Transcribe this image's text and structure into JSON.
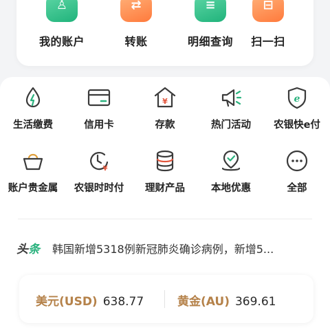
{
  "top_actions": [
    {
      "label": "我的账户",
      "icon": "account-icon",
      "color": "#20b37b"
    },
    {
      "label": "转账",
      "icon": "transfer-icon",
      "color": "#ff7a3c"
    },
    {
      "label": "明细查询",
      "icon": "detail-query-icon",
      "color": "#20b37b"
    },
    {
      "label": "扫一扫",
      "icon": "scan-icon",
      "color": "#ff7a3c"
    }
  ],
  "services": [
    {
      "label": "生活缴费",
      "icon": "water-drop-icon"
    },
    {
      "label": "信用卡",
      "icon": "credit-card-icon"
    },
    {
      "label": "存款",
      "icon": "deposit-house-icon"
    },
    {
      "label": "热门活动",
      "icon": "megaphone-icon"
    },
    {
      "label": "农银快e付",
      "icon": "e-pay-shield-icon"
    },
    {
      "label": "账户贵金属",
      "icon": "gold-bowl-icon"
    },
    {
      "label": "农银时时付",
      "icon": "clock-yuan-icon"
    },
    {
      "label": "理财产品",
      "icon": "coin-stack-icon"
    },
    {
      "label": "本地优惠",
      "icon": "location-pin-icon"
    },
    {
      "label": "全部",
      "icon": "more-dots-icon"
    }
  ],
  "news": {
    "tag_part1": "头",
    "tag_part2": "条",
    "headline": "韩国新增5318例新冠肺炎确诊病例，新增5..."
  },
  "rates": {
    "usd_label": "美元(USD)",
    "usd_value": "638.77",
    "gold_label": "黄金(AU)",
    "gold_value": "369.61"
  },
  "colors": {
    "accent_green": "#2bb27e",
    "accent_orange": "#ff7a3c",
    "rate_label": "#b5824a",
    "icon_stroke": "#3a3a3a"
  }
}
